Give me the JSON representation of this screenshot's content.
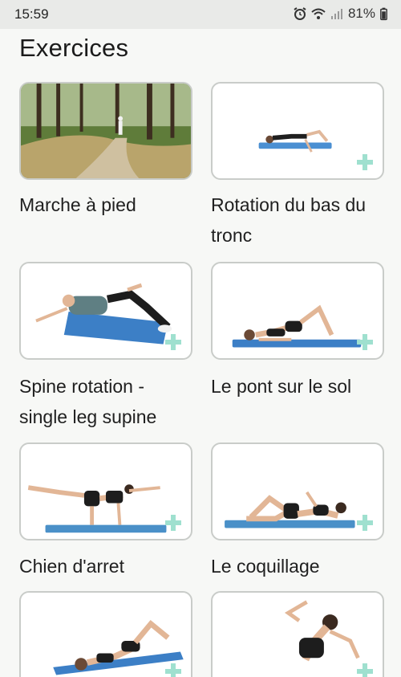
{
  "status_bar": {
    "time": "15:59",
    "battery": "81%",
    "icons": [
      "alarm-icon",
      "wifi-icon",
      "signal-icon",
      "battery-icon"
    ]
  },
  "header": {
    "title": "Exercices"
  },
  "exercises": [
    {
      "name": "Marche à pied",
      "image": "forest-path-walking"
    },
    {
      "name": "Rotation du bas du tronc",
      "image": "lying-knee-rotation"
    },
    {
      "name": "Spine rotation - single leg supine",
      "image": "supine-spine-twist"
    },
    {
      "name": "Le pont sur le sol",
      "image": "floor-bridge"
    },
    {
      "name": "Chien d'arret",
      "image": "bird-dog-pose"
    },
    {
      "name": "Le coquillage",
      "image": "clamshell-side-lying"
    },
    {
      "name": "",
      "image": "supine-stretch"
    },
    {
      "name": "",
      "image": "standing-side-bend"
    }
  ],
  "colors": {
    "accent_plus": "#9fe0cf",
    "mat_blue": "#4a8fd2",
    "card_border": "#c9ccc9"
  }
}
